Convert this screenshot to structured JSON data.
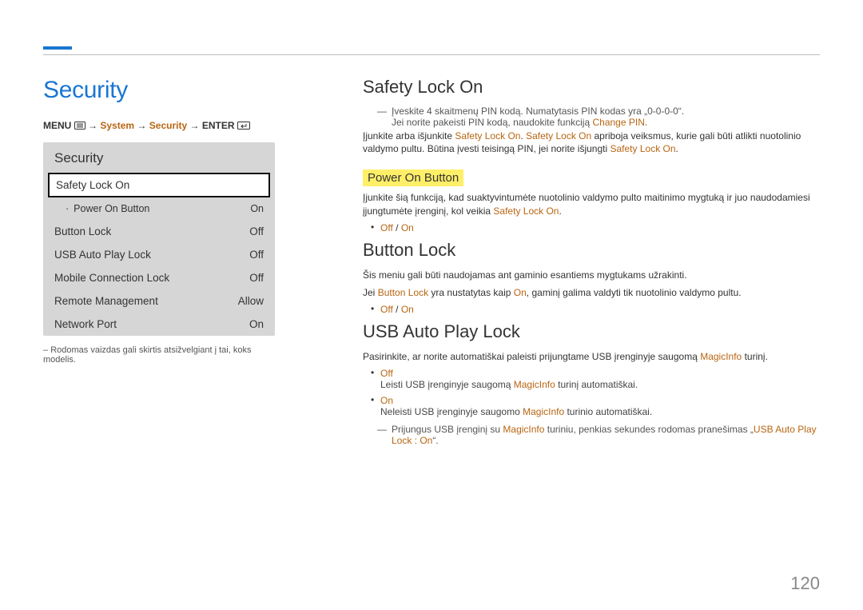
{
  "page_number": "120",
  "left": {
    "title": "Security",
    "breadcrumb": {
      "prefix": "MENU",
      "item1": "System",
      "item2": "Security",
      "suffix": "ENTER"
    },
    "panel": {
      "title": "Security",
      "selected": "Safety Lock On",
      "rows": [
        {
          "label": "Power On Button",
          "value": "On",
          "sub": true
        },
        {
          "label": "Button Lock",
          "value": "Off"
        },
        {
          "label": "USB Auto Play Lock",
          "value": "Off"
        },
        {
          "label": "Mobile Connection Lock",
          "value": "Off"
        },
        {
          "label": "Remote Management",
          "value": "Allow"
        },
        {
          "label": "Network Port",
          "value": "On"
        }
      ]
    },
    "panel_note_prefix": "–",
    "panel_note_text": "Rodomas vaizdas gali skirtis atsižvelgiant į tai, koks modelis."
  },
  "right": {
    "s1": {
      "h": "Safety Lock On",
      "note1a": "Įveskite 4 skaitmenų PIN kodą. Numatytasis PIN kodas yra „0-0-0-0“.",
      "note1b_pre": "Jei norite pakeisti PIN kodą, naudokite funkciją ",
      "note1b_orange": "Change PIN",
      "note1b_post": ".",
      "p1_pre": "Įjunkite arba išjunkite ",
      "p1_a": "Safety Lock On",
      "p1_mid": ". ",
      "p1_b": "Safety Lock On",
      "p1_mid2": " apriboja veiksmus, kurie gali būti atlikti nuotolinio valdymo pultu. Būtina įvesti teisingą PIN, jei norite išjungti ",
      "p1_c": "Safety Lock On",
      "p1_post": "."
    },
    "pob": {
      "h": "Power On Button",
      "p_pre": "Įjunkite šią funkciją, kad suaktyvintumėte nuotolinio valdymo pulto maitinimo mygtuką ir juo naudodamiesi įjungtumėte įrenginį, kol veikia ",
      "p_a": "Safety Lock On",
      "p_post": ".",
      "opt_off": "Off",
      "opt_sep": " / ",
      "opt_on": "On"
    },
    "bl": {
      "h": "Button Lock",
      "p1": "Šis meniu gali būti naudojamas ant gaminio esantiems mygtukams užrakinti.",
      "p2_pre": "Jei ",
      "p2_a": "Button Lock",
      "p2_mid": " yra nustatytas kaip ",
      "p2_b": "On",
      "p2_post": ", gaminį galima valdyti tik nuotolinio valdymo pultu.",
      "opt_off": "Off",
      "opt_sep": " / ",
      "opt_on": "On"
    },
    "uapl": {
      "h": "USB Auto Play Lock",
      "p_pre": "Pasirinkite, ar norite automatiškai paleisti prijungtame USB įrenginyje saugomą ",
      "p_a": "MagicInfo",
      "p_post": " turinį.",
      "off_label": "Off",
      "off_pre": "Leisti USB įrenginyje saugomą ",
      "off_a": "MagicInfo",
      "off_post": " turinį automatiškai.",
      "on_label": "On",
      "on_pre": "Neleisti USB įrenginyje saugomo ",
      "on_a": "MagicInfo",
      "on_post": " turinio automatiškai.",
      "tail_pre": "Prijungus USB įrenginį su ",
      "tail_a": "MagicInfo",
      "tail_mid": " turiniu, penkias sekundes rodomas pranešimas „",
      "tail_b": "USB Auto Play Lock : On",
      "tail_post": "“."
    }
  },
  "glyphs": {
    "arrow": "→",
    "dash": "―",
    "bullet": "·"
  }
}
